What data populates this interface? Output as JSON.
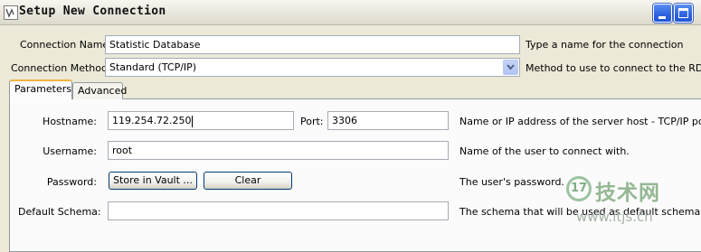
{
  "window": {
    "title": "Setup New Connection",
    "icons": {
      "app": "app-window-icon",
      "minimize": "minimize-icon",
      "maximize": "maximize-icon"
    }
  },
  "connection": {
    "name_label": "Connection Name:",
    "name_value": "Statistic Database",
    "name_hint": "Type a name for the connection",
    "method_label": "Connection Method:",
    "method_value": "Standard (TCP/IP)",
    "method_hint": "Method to use to connect to the RDBMS",
    "method_arrow_icon": "chevron-down-icon"
  },
  "tabs": [
    {
      "label": "Parameters",
      "active": true
    },
    {
      "label": "Advanced",
      "active": false
    }
  ],
  "params": {
    "hostname_label": "Hostname:",
    "hostname_value": "119.254.72.250",
    "port_label": "Port:",
    "port_value": "3306",
    "host_hint": "Name or IP address of the server host - TCP/IP port",
    "username_label": "Username:",
    "username_value": "root",
    "username_hint": "Name of the user to connect with.",
    "password_label": "Password:",
    "store_button": "Store in Vault ...",
    "clear_button": "Clear",
    "password_hint": "The user's password.",
    "schema_label": "Default Schema:",
    "schema_value": "",
    "schema_hint": "The schema that will be used as default schema"
  },
  "watermark": {
    "logo_text": "17",
    "name": "技术网",
    "url": "www.itjs.cn"
  }
}
